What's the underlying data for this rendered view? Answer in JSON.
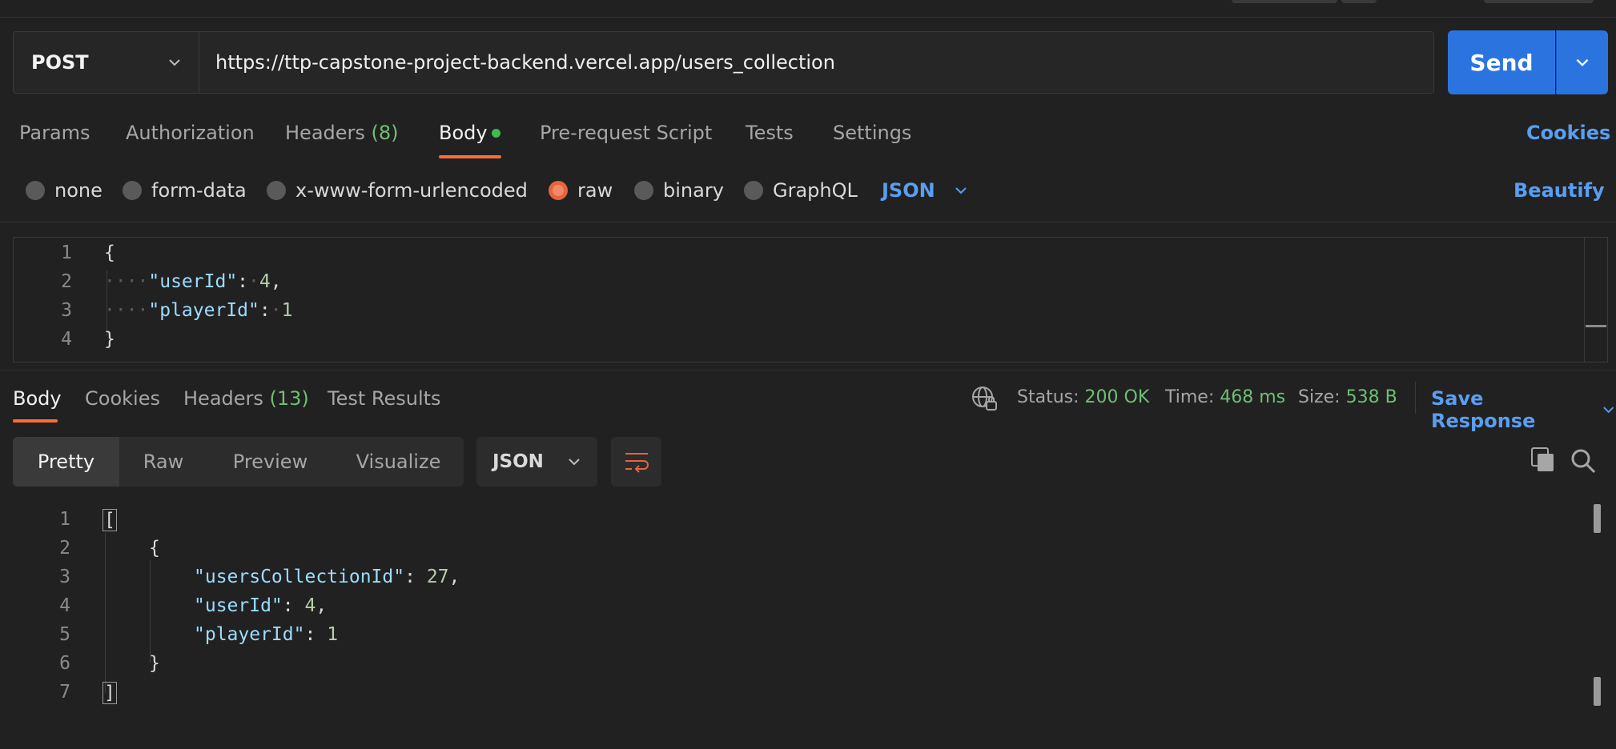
{
  "request": {
    "method": "POST",
    "url": "https://ttp-capstone-project-backend.vercel.app/users_collection",
    "send_label": "Send"
  },
  "request_tabs": [
    {
      "label": "Params"
    },
    {
      "label": "Authorization"
    },
    {
      "label": "Headers",
      "count": "(8)"
    },
    {
      "label": "Body"
    },
    {
      "label": "Pre-request Script"
    },
    {
      "label": "Tests"
    },
    {
      "label": "Settings"
    }
  ],
  "cookies_label": "Cookies",
  "body_types": [
    "none",
    "form-data",
    "x-www-form-urlencoded",
    "raw",
    "binary",
    "GraphQL"
  ],
  "body_type_selected": "raw",
  "body_language": "JSON",
  "beautify_label": "Beautify",
  "request_body": {
    "line_numbers": [
      "1",
      "2",
      "3",
      "4"
    ],
    "lines": {
      "open": "{",
      "k1": "\"userId\"",
      "v1": "4",
      "k2": "\"playerId\"",
      "v2": "1",
      "close": "}"
    }
  },
  "response_tabs": [
    {
      "label": "Body"
    },
    {
      "label": "Cookies"
    },
    {
      "label": "Headers",
      "count": "(13)"
    },
    {
      "label": "Test Results"
    }
  ],
  "response_meta": {
    "status_label": "Status:",
    "status_value": "200 OK",
    "time_label": "Time:",
    "time_value": "468 ms",
    "size_label": "Size:",
    "size_value": "538 B",
    "save_label": "Save Response"
  },
  "view_modes": [
    "Pretty",
    "Raw",
    "Preview",
    "Visualize"
  ],
  "response_language": "JSON",
  "response_body": {
    "line_numbers": [
      "1",
      "2",
      "3",
      "4",
      "5",
      "6",
      "7"
    ],
    "lines": {
      "open_bracket": "[",
      "open_brace": "{",
      "k1": "\"usersCollectionId\"",
      "v1": "27",
      "k2": "\"userId\"",
      "v2": "4",
      "k3": "\"playerId\"",
      "v3": "1",
      "close_brace": "}",
      "close_bracket": "]"
    }
  },
  "colors": {
    "accent": "#ff6c37",
    "primary": "#2b74e0",
    "link": "#5a9ef0",
    "success": "#6fbf73",
    "background": "#212121"
  }
}
